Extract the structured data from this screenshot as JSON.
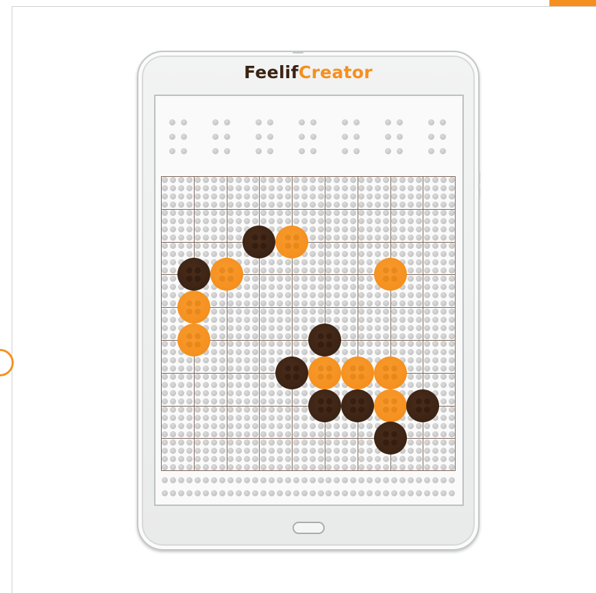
{
  "branding": {
    "name_part1": "Feelif",
    "name_part2": "Creator",
    "colors": {
      "dark": "#3b2314",
      "orange": "#f5901e"
    }
  },
  "board": {
    "columns": 9,
    "rows": 9,
    "pieces": [
      {
        "col": 3,
        "row": 2,
        "color": "dark"
      },
      {
        "col": 4,
        "row": 2,
        "color": "orange"
      },
      {
        "col": 1,
        "row": 3,
        "color": "dark"
      },
      {
        "col": 2,
        "row": 3,
        "color": "orange"
      },
      {
        "col": 7,
        "row": 3,
        "color": "orange"
      },
      {
        "col": 1,
        "row": 4,
        "color": "orange"
      },
      {
        "col": 1,
        "row": 5,
        "color": "orange"
      },
      {
        "col": 5,
        "row": 5,
        "color": "dark"
      },
      {
        "col": 4,
        "row": 6,
        "color": "dark"
      },
      {
        "col": 5,
        "row": 6,
        "color": "orange"
      },
      {
        "col": 6,
        "row": 6,
        "color": "orange"
      },
      {
        "col": 7,
        "row": 6,
        "color": "orange"
      },
      {
        "col": 5,
        "row": 7,
        "color": "dark"
      },
      {
        "col": 6,
        "row": 7,
        "color": "dark"
      },
      {
        "col": 7,
        "row": 7,
        "color": "orange"
      },
      {
        "col": 8,
        "row": 7,
        "color": "dark"
      },
      {
        "col": 7,
        "row": 8,
        "color": "dark"
      }
    ]
  },
  "icons": {
    "home_button": "home-button-icon",
    "braille_pins": "braille-pin-icon"
  }
}
